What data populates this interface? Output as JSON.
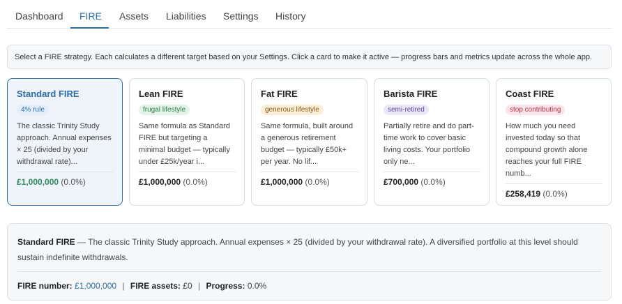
{
  "tabs": [
    {
      "label": "Dashboard"
    },
    {
      "label": "FIRE"
    },
    {
      "label": "Assets"
    },
    {
      "label": "Liabilities"
    },
    {
      "label": "Settings"
    },
    {
      "label": "History"
    }
  ],
  "active_tab": "FIRE",
  "info_text": "Select a FIRE strategy. Each calculates a different target based on your Settings. Click a card to make it active — progress bars and metrics update across the whole app.",
  "cards": [
    {
      "title": "Standard FIRE",
      "badge": "4% rule",
      "badge_color": "#2e6ea8",
      "description": "The classic Trinity Study approach. Annual expenses × 25 (divided by your withdrawal rate)...",
      "value": "£1,000,000",
      "pct": "(0.0%)",
      "active": true
    },
    {
      "title": "Lean FIRE",
      "badge": "frugal lifestyle",
      "badge_color": "#2f7d4f",
      "description": "Same formula as Standard FIRE but targeting a minimal budget — typically under £25k/year i...",
      "value": "£1,000,000",
      "pct": "(0.0%)",
      "active": false
    },
    {
      "title": "Fat FIRE",
      "badge": "generous lifestyle",
      "badge_color": "#8a5a12",
      "description": "Same formula, built around a generous retirement budget — typically £50k+ per year. No lif...",
      "value": "£1,000,000",
      "pct": "(0.0%)",
      "active": false
    },
    {
      "title": "Barista FIRE",
      "badge": "semi-retired",
      "badge_color": "#5b4a9e",
      "description": "Partially retire and do part-time work to cover basic living costs. Your portfolio only ne...",
      "value": "£700,000",
      "pct": "(0.0%)",
      "active": false
    },
    {
      "title": "Coast FIRE",
      "badge": "stop contributing",
      "badge_color": "#b2344b",
      "description": "How much you need invested today so that compound growth alone reaches your full FIRE numb...",
      "value": "£258,419",
      "pct": "(0.0%)",
      "active": false
    }
  ],
  "summary": {
    "name": "Standard FIRE",
    "description": " — The classic Trinity Study approach. Annual expenses × 25 (divided by your withdrawal rate). A diversified portfolio at this level should sustain indefinite withdrawals.",
    "fire_number_label": "FIRE number:",
    "fire_number": "£1,000,000",
    "fire_assets_label": "FIRE assets:",
    "fire_assets": "£0",
    "progress_label": "Progress:",
    "progress": "0.0%",
    "separator": "|"
  }
}
